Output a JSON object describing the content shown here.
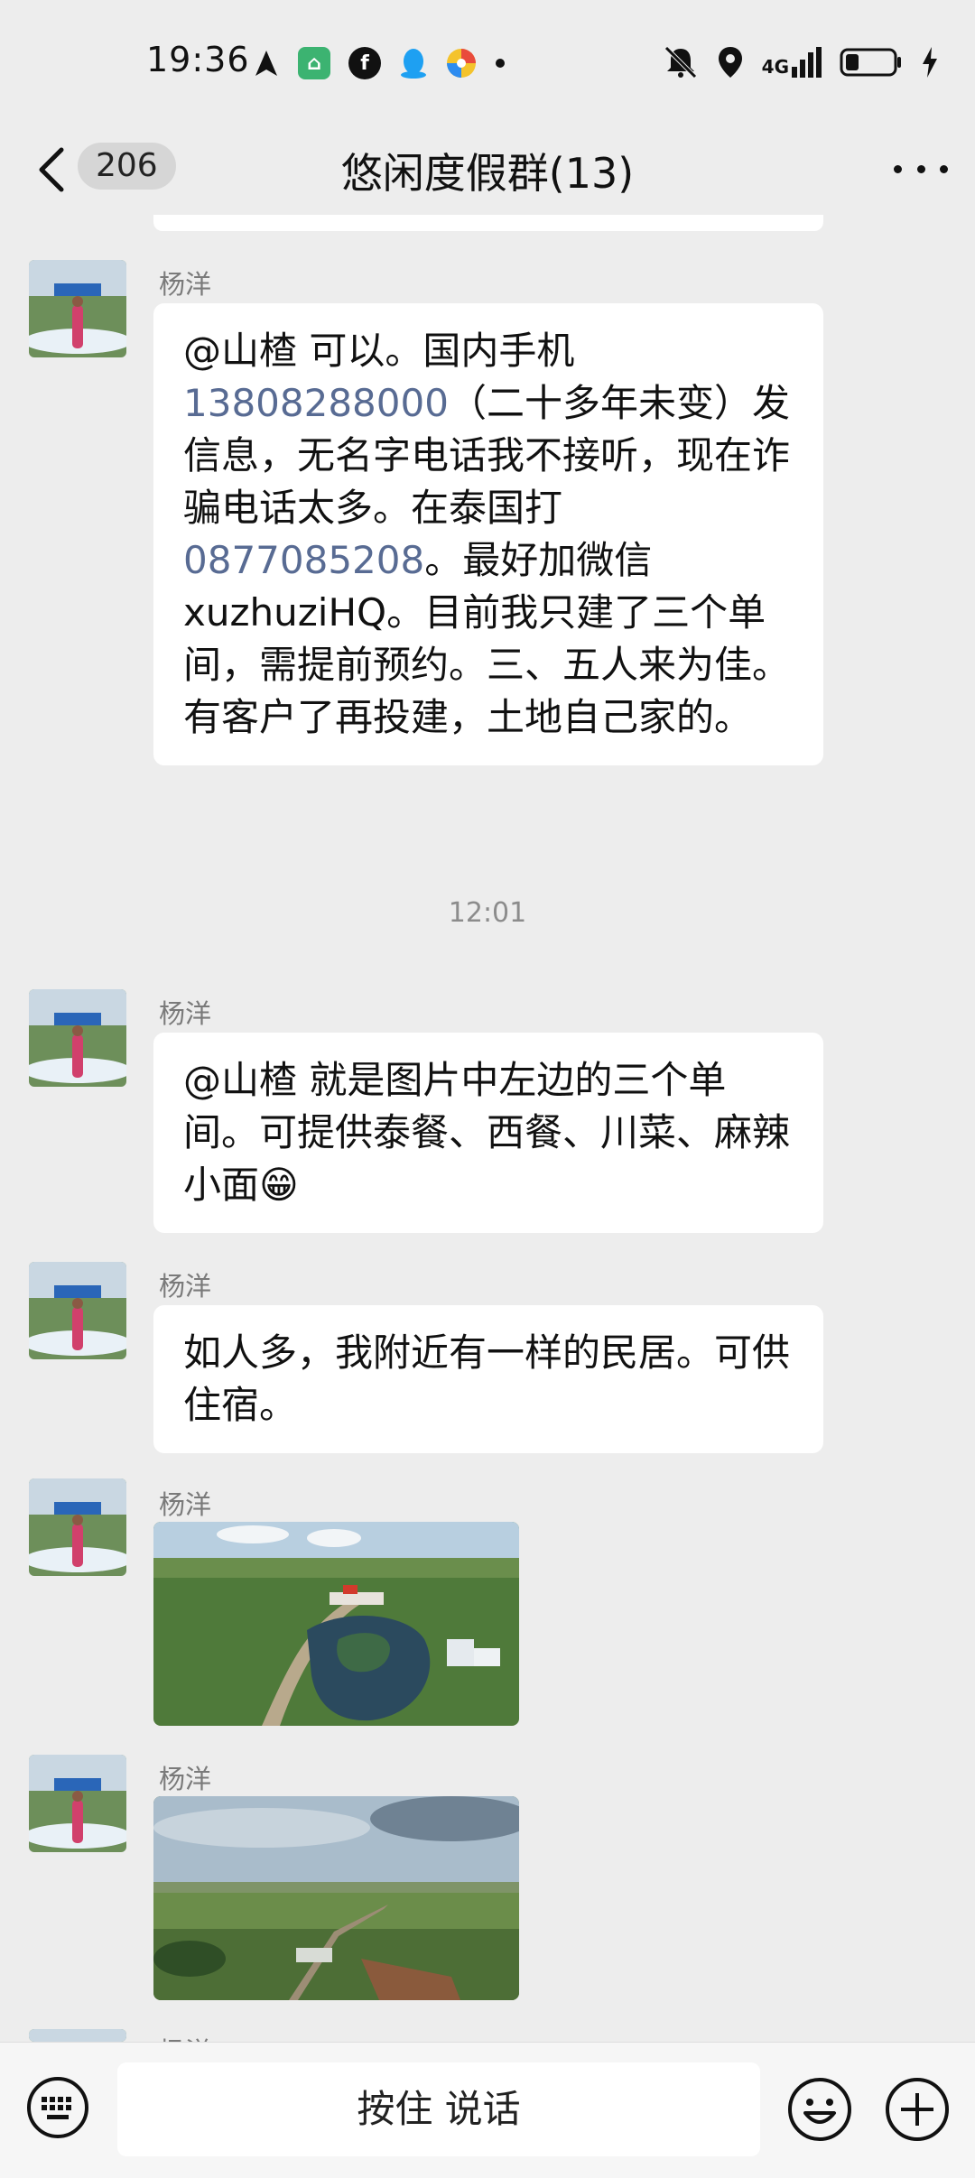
{
  "status_bar": {
    "time": "19:36",
    "network": "4G"
  },
  "header": {
    "unread_count": "206",
    "title": "悠闲度假群(13)"
  },
  "messages": [
    {
      "sender": "杨洋",
      "parts": [
        "@山楂  可以。国内手机",
        "13808288000",
        "（二十多年未变）发信息，无名字电话我不接听，现在诈骗电话太多。在泰国打",
        "0877085208",
        "。最好加微信xuzhuziHQ。目前我只建了三个单间，需提前预约。三、五人来为佳。有客户了再投建，土地自己家的。"
      ]
    },
    {
      "sender": "杨洋",
      "text": "@山楂  就是图片中左边的三个单间。可提供泰餐、西餐、川菜、麻辣小面😁"
    },
    {
      "sender": "杨洋",
      "text": "如人多，我附近有一样的民居。可供住宿。"
    },
    {
      "sender": "杨洋"
    },
    {
      "sender": "杨洋"
    },
    {
      "sender": "杨洋"
    }
  ],
  "timestamp": "12:01",
  "input_bar": {
    "voice_label": "按住 说话"
  },
  "colors": {
    "background": "#ededed",
    "bubble": "#ffffff",
    "phone_link": "#586b93"
  }
}
